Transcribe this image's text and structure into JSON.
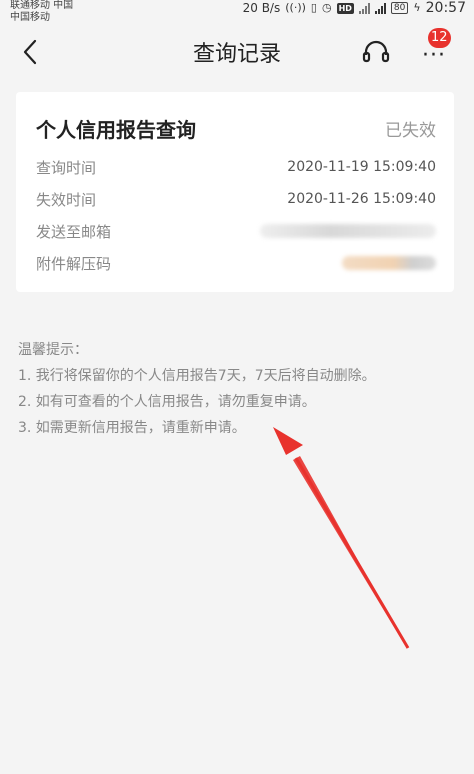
{
  "status_bar": {
    "carrier_line1": "联通移动 中国",
    "carrier_line2": "中国移动",
    "speed": "20 B/s",
    "battery": "80",
    "time": "20:57"
  },
  "header": {
    "title": "查询记录",
    "badge_count": "12",
    "back_icon": "chevron-left-icon",
    "headset_icon": "headset-icon",
    "more_icon": "more-icon"
  },
  "record": {
    "title": "个人信用报告查询",
    "status": "已失效",
    "rows": [
      {
        "label": "查询时间",
        "value": "2020-11-19 15:09:40"
      },
      {
        "label": "失效时间",
        "value": "2020-11-26 15:09:40"
      },
      {
        "label": "发送至邮箱",
        "value": ""
      },
      {
        "label": "附件解压码",
        "value": ""
      }
    ]
  },
  "tips": {
    "heading": "温馨提示：",
    "items": [
      "1. 我行将保留你的个人信用报告7天，7天后将自动删除。",
      "2. 如有可查看的个人信用报告，请勿重复申请。",
      "3. 如需更新信用报告，请重新申请。"
    ]
  },
  "colors": {
    "badge": "#e8322d",
    "arrow": "#e8322d",
    "background": "#f4f4f4"
  }
}
